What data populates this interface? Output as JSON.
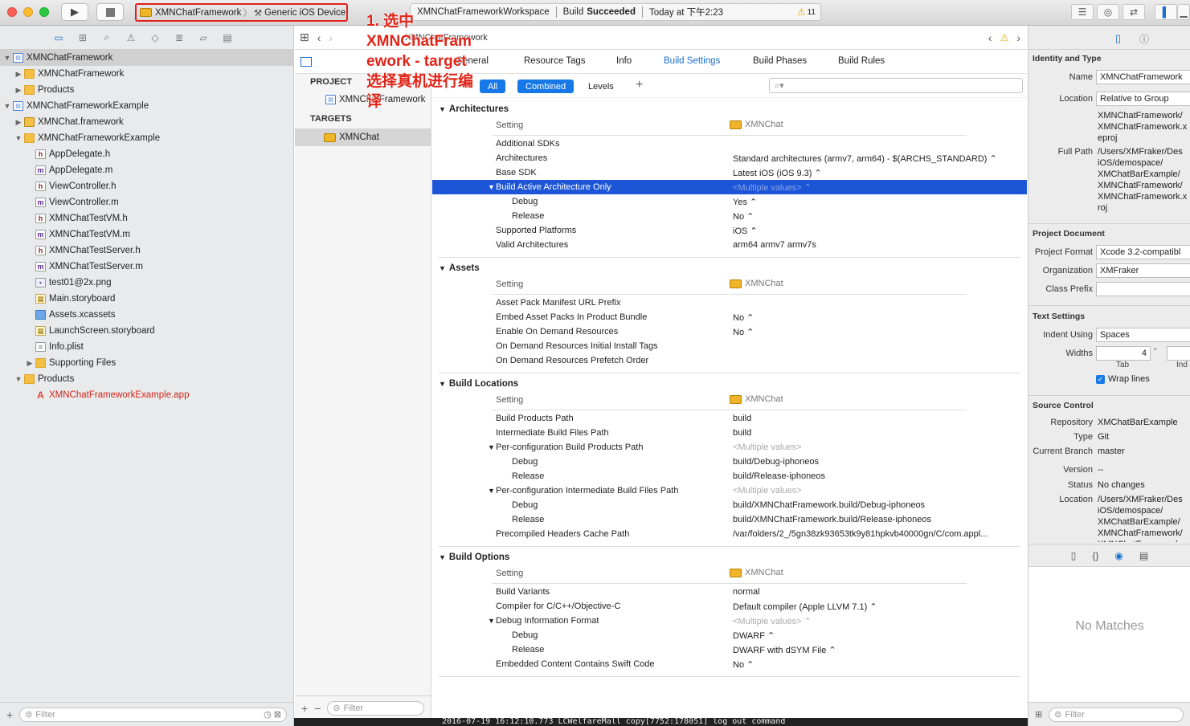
{
  "toolbar": {
    "scheme_name": "XMNChatFramework",
    "scheme_device": "Generic iOS Device",
    "status_project": "XMNChatFrameworkWorkspace",
    "status_build_prefix": "Build",
    "status_build_result": "Succeeded",
    "status_time": "Today at 下午2:23",
    "warning_count": "11"
  },
  "annotation": {
    "text": "1. 选中\nXMNChatFram\nework - target\n选择真机进行编\n译"
  },
  "navigator": {
    "filter_placeholder": "Filter",
    "items": [
      {
        "label": "XMNChatFramework",
        "icon": "project-icon",
        "indent": 0,
        "disclosure": "▼",
        "selected": true
      },
      {
        "label": "XMNChatFramework",
        "icon": "folder-icon",
        "indent": 1,
        "disclosure": "▶"
      },
      {
        "label": "Products",
        "icon": "folder-icon",
        "indent": 1,
        "disclosure": "▶"
      },
      {
        "label": "XMNChatFrameworkExample",
        "icon": "project-icon",
        "indent": 0,
        "disclosure": "▼"
      },
      {
        "label": "XMNChat.framework",
        "icon": "framework-icon",
        "indent": 1,
        "disclosure": "▶"
      },
      {
        "label": "XMNChatFrameworkExample",
        "icon": "folder-icon",
        "indent": 1,
        "disclosure": "▼"
      },
      {
        "label": "AppDelegate.h",
        "icon": "h-file-icon",
        "indent": 2
      },
      {
        "label": "AppDelegate.m",
        "icon": "m-file-icon",
        "indent": 2
      },
      {
        "label": "ViewController.h",
        "icon": "h-file-icon",
        "indent": 2
      },
      {
        "label": "ViewController.m",
        "icon": "m-file-icon",
        "indent": 2
      },
      {
        "label": "XMNChatTestVM.h",
        "icon": "h-file-icon",
        "indent": 2
      },
      {
        "label": "XMNChatTestVM.m",
        "icon": "m-file-icon",
        "indent": 2
      },
      {
        "label": "XMNChatTestServer.h",
        "icon": "h-file-icon",
        "indent": 2
      },
      {
        "label": "XMNChatTestServer.m",
        "icon": "m-file-icon",
        "indent": 2
      },
      {
        "label": "test01@2x.png",
        "icon": "image-file-icon",
        "indent": 2
      },
      {
        "label": "Main.storyboard",
        "icon": "storyboard-icon",
        "indent": 2
      },
      {
        "label": "Assets.xcassets",
        "icon": "xcassets-icon",
        "indent": 2
      },
      {
        "label": "LaunchScreen.storyboard",
        "icon": "storyboard-icon",
        "indent": 2
      },
      {
        "label": "Info.plist",
        "icon": "plist-icon",
        "indent": 2
      },
      {
        "label": "Supporting Files",
        "icon": "folder-icon",
        "indent": 2,
        "disclosure": "▶"
      },
      {
        "label": "Products",
        "icon": "folder-icon",
        "indent": 1,
        "disclosure": "▼"
      },
      {
        "label": "XMNChatFrameworkExample.app",
        "icon": "app-icon",
        "indent": 2,
        "red": true
      }
    ]
  },
  "editor": {
    "breadcrumb": "XMNChatFramework",
    "tabs": [
      "General",
      "Resource Tags",
      "Info",
      "Build Settings",
      "Build Phases",
      "Build Rules"
    ],
    "active_tab": "Build Settings",
    "filter_all": "All",
    "filter_combined": "Combined",
    "filter_levels": "Levels",
    "search_placeholder": "",
    "project_header": "PROJECT",
    "project_item": "XMNChatFramework",
    "targets_header": "TARGETS",
    "target_item": "XMNChat",
    "targets_filter_placeholder": "Filter",
    "column_setting": "Setting",
    "column_target": "XMNChat",
    "sections": [
      {
        "title": "Architectures",
        "rows": [
          {
            "k": "Additional SDKs",
            "v": ""
          },
          {
            "k": "Architectures",
            "v": "Standard architectures (armv7, arm64)  -  $(ARCHS_STANDARD) ⌃"
          },
          {
            "k": "Base SDK",
            "v": "Latest iOS (iOS 9.3) ⌃"
          },
          {
            "k": "Build Active Architecture Only",
            "v": "<Multiple values> ⌃",
            "hl": true,
            "tri": true,
            "grey": true
          },
          {
            "k": "Debug",
            "v": "Yes ⌃",
            "sub": true
          },
          {
            "k": "Release",
            "v": "No ⌃",
            "sub": true
          },
          {
            "k": "Supported Platforms",
            "v": "iOS ⌃"
          },
          {
            "k": "Valid Architectures",
            "v": "arm64 armv7 armv7s"
          }
        ]
      },
      {
        "title": "Assets",
        "rows": [
          {
            "k": "Asset Pack Manifest URL Prefix",
            "v": ""
          },
          {
            "k": "Embed Asset Packs In Product Bundle",
            "v": "No ⌃"
          },
          {
            "k": "Enable On Demand Resources",
            "v": "No ⌃"
          },
          {
            "k": "On Demand Resources Initial Install Tags",
            "v": ""
          },
          {
            "k": "On Demand Resources Prefetch Order",
            "v": ""
          }
        ]
      },
      {
        "title": "Build Locations",
        "rows": [
          {
            "k": "Build Products Path",
            "v": "build"
          },
          {
            "k": "Intermediate Build Files Path",
            "v": "build"
          },
          {
            "k": "Per-configuration Build Products Path",
            "v": "<Multiple values>",
            "tri": true,
            "grey": true
          },
          {
            "k": "Debug",
            "v": "build/Debug-iphoneos",
            "sub": true
          },
          {
            "k": "Release",
            "v": "build/Release-iphoneos",
            "sub": true
          },
          {
            "k": "Per-configuration Intermediate Build Files Path",
            "v": "<Multiple values>",
            "tri": true,
            "grey": true
          },
          {
            "k": "Debug",
            "v": "build/XMNChatFramework.build/Debug-iphoneos",
            "sub": true
          },
          {
            "k": "Release",
            "v": "build/XMNChatFramework.build/Release-iphoneos",
            "sub": true
          },
          {
            "k": "Precompiled Headers Cache Path",
            "v": "/var/folders/2_/5gn38zk93653tk9y81hpkvb40000gn/C/com.appl..."
          }
        ]
      },
      {
        "title": "Build Options",
        "rows": [
          {
            "k": "Build Variants",
            "v": "normal"
          },
          {
            "k": "Compiler for C/C++/Objective-C",
            "v": "Default compiler (Apple LLVM 7.1) ⌃"
          },
          {
            "k": "Debug Information Format",
            "v": "<Multiple values> ⌃",
            "tri": true,
            "grey": true
          },
          {
            "k": "Debug",
            "v": "DWARF ⌃",
            "sub": true
          },
          {
            "k": "Release",
            "v": "DWARF with dSYM File ⌃",
            "sub": true
          },
          {
            "k": "Embedded Content Contains Swift Code",
            "v": "No ⌃"
          }
        ]
      }
    ]
  },
  "inspector": {
    "identity_header": "Identity and Type",
    "name_label": "Name",
    "name_value": "XMNChatFramework",
    "location_label": "Location",
    "location_value": "Relative to Group",
    "location_path": "XMNChatFramework/\nXMNChatFramework.x\neproj",
    "full_path_label": "Full Path",
    "full_path_value": "/Users/XMFraker/Des\niOS/demospace/\nXMChatBarExample/\nXMNChatFramework/\nXMNChatFramework.x\nroj",
    "project_doc_header": "Project Document",
    "project_format_label": "Project Format",
    "project_format_value": "Xcode 3.2-compatibl",
    "organization_label": "Organization",
    "organization_value": "XMFraker",
    "class_prefix_label": "Class Prefix",
    "class_prefix_value": "",
    "text_settings_header": "Text Settings",
    "indent_using_label": "Indent Using",
    "indent_using_value": "Spaces",
    "widths_label": "Widths",
    "widths_value": "4",
    "tab_label": "Tab",
    "indent_label": "Ind",
    "wrap_lines_label": "Wrap lines",
    "source_control_header": "Source Control",
    "repository_label": "Repository",
    "repository_value": "XMChatBarExample",
    "type_label": "Type",
    "type_value": "Git",
    "branch_label": "Current Branch",
    "branch_value": "master",
    "version_label": "Version",
    "version_value": "--",
    "status_label": "Status",
    "status_value": "No changes",
    "sc_location_label": "Location",
    "sc_location_value": "/Users/XMFraker/Des\niOS/demospace/\nXMChatBarExample/\nXMNChatFramework/\nXMNChatFramework.x",
    "no_matches": "No Matches",
    "filter_placeholder": "Filter"
  },
  "console": {
    "line": "2016-07-19 16:12:10.773 LCWelfareMall copy[7752:178051] log out command"
  }
}
